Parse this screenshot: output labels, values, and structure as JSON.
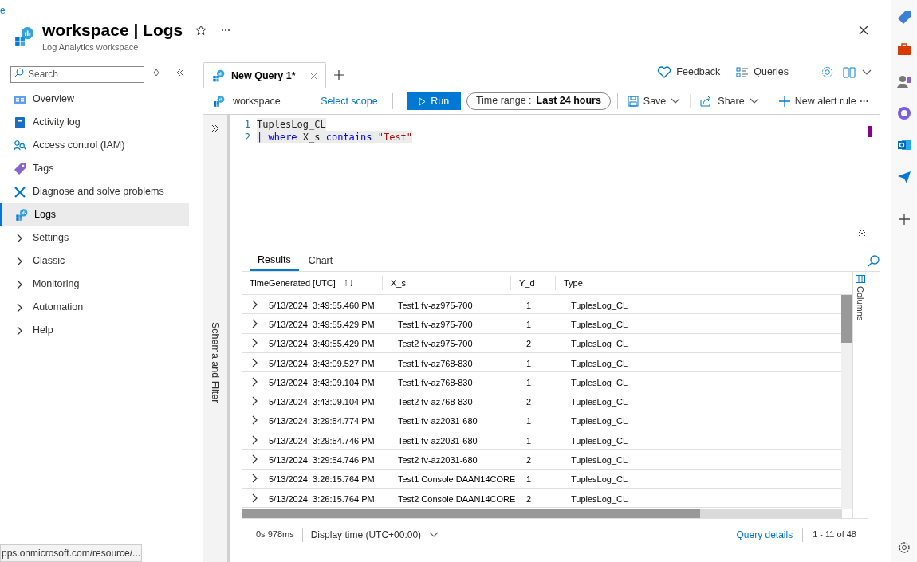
{
  "corner_link": "e",
  "header": {
    "title": "workspace | Logs",
    "subtitle": "Log Analytics workspace"
  },
  "sidebar": {
    "search": {
      "placeholder": "Search"
    },
    "items": [
      {
        "label": "Overview",
        "kind": "overview",
        "selected": false
      },
      {
        "label": "Activity log",
        "kind": "activity",
        "selected": false
      },
      {
        "label": "Access control (IAM)",
        "kind": "iam",
        "selected": false
      },
      {
        "label": "Tags",
        "kind": "tags",
        "selected": false
      },
      {
        "label": "Diagnose and solve problems",
        "kind": "diagnose",
        "selected": false
      },
      {
        "label": "Logs",
        "kind": "logs",
        "selected": true
      },
      {
        "label": "Settings",
        "kind": "group",
        "selected": false
      },
      {
        "label": "Classic",
        "kind": "group",
        "selected": false
      },
      {
        "label": "Monitoring",
        "kind": "group",
        "selected": false
      },
      {
        "label": "Automation",
        "kind": "group",
        "selected": false
      },
      {
        "label": "Help",
        "kind": "group",
        "selected": false
      }
    ]
  },
  "query_tabs": [
    {
      "label": "New Query 1*",
      "selected": true
    }
  ],
  "top_actions": [
    {
      "label": "Feedback",
      "kind": "heart"
    },
    {
      "label": "Queries",
      "kind": "list"
    }
  ],
  "toolbar": {
    "scope": "workspace",
    "select_scope": "Select scope",
    "run": "Run",
    "time_range_label": "Time range :",
    "time_range_value": "Last 24 hours",
    "actions": [
      {
        "label": "Save",
        "kind": "save"
      },
      {
        "label": "Share",
        "kind": "share"
      },
      {
        "label": "New alert rule",
        "kind": "plus"
      }
    ]
  },
  "side_panel": "Schema and Filter",
  "editor": {
    "lines": [
      {
        "number": "1",
        "tokens": [
          {
            "text": "TuplesLog_CL",
            "kind": "plain"
          }
        ]
      },
      {
        "number": "2",
        "tokens": [
          {
            "text": "| ",
            "kind": "operator"
          },
          {
            "text": "where",
            "kind": "keyword"
          },
          {
            "text": " X_s ",
            "kind": "plain"
          },
          {
            "text": "contains",
            "kind": "keyword"
          },
          {
            "text": " \"Test\"",
            "kind": "string"
          }
        ]
      }
    ]
  },
  "result_tabs": [
    {
      "label": "Results",
      "selected": true
    },
    {
      "label": "Chart",
      "selected": false
    }
  ],
  "table": {
    "columns": [
      "TimeGenerated [UTC]",
      "X_s",
      "Y_d",
      "Type"
    ],
    "rows": [
      [
        "5/13/2024, 3:49:55.460 PM",
        "Test1 fv-az975-700",
        "1",
        "TuplesLog_CL"
      ],
      [
        "5/13/2024, 3:49:55.429 PM",
        "Test1 fv-az975-700",
        "1",
        "TuplesLog_CL"
      ],
      [
        "5/13/2024, 3:49:55.429 PM",
        "Test2 fv-az975-700",
        "2",
        "TuplesLog_CL"
      ],
      [
        "5/13/2024, 3:43:09.527 PM",
        "Test1 fv-az768-830",
        "1",
        "TuplesLog_CL"
      ],
      [
        "5/13/2024, 3:43:09.104 PM",
        "Test1 fv-az768-830",
        "1",
        "TuplesLog_CL"
      ],
      [
        "5/13/2024, 3:43:09.104 PM",
        "Test2 fv-az768-830",
        "2",
        "TuplesLog_CL"
      ],
      [
        "5/13/2024, 3:29:54.774 PM",
        "Test1 fv-az2031-680",
        "1",
        "TuplesLog_CL"
      ],
      [
        "5/13/2024, 3:29:54.746 PM",
        "Test1 fv-az2031-680",
        "1",
        "TuplesLog_CL"
      ],
      [
        "5/13/2024, 3:29:54.746 PM",
        "Test2 fv-az2031-680",
        "2",
        "TuplesLog_CL"
      ],
      [
        "5/13/2024, 3:26:15.764 PM",
        "Test1 Console DAAN14CORE",
        "1",
        "TuplesLog_CL"
      ],
      [
        "5/13/2024, 3:26:15.764 PM",
        "Test2 Console DAAN14CORE",
        "2",
        "TuplesLog_CL"
      ]
    ]
  },
  "columns_panel": "Columns",
  "status_bar": {
    "duration": "0s 978ms",
    "display_time": "Display time (UTC+00:00)",
    "query_details": "Query details",
    "count": "1 - 11 of 48"
  },
  "url_tooltip": "pps.onmicrosoft.com/resource/..."
}
